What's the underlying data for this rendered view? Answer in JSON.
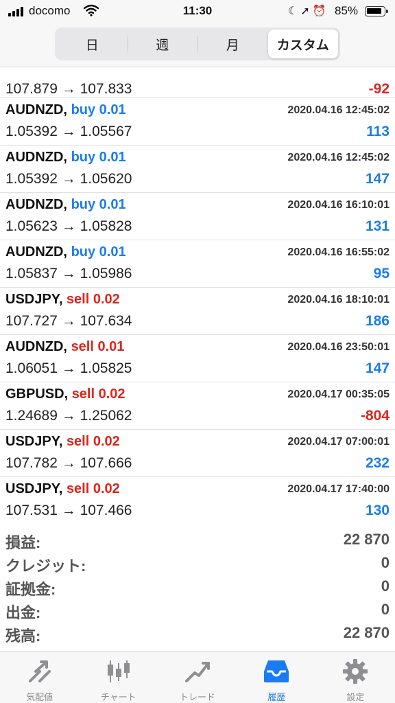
{
  "status_bar": {
    "carrier": "docomo",
    "time": "11:30",
    "battery": "85%",
    "icons": [
      "moon-icon",
      "location-icon",
      "alarm-icon"
    ]
  },
  "header": {
    "segments": [
      "日",
      "週",
      "月",
      "カスタム"
    ],
    "active_segment": "カスタム"
  },
  "trades": {
    "partial": {
      "prices": "107.879 → 107.833",
      "profit": "-92"
    },
    "rows": [
      {
        "symbol": "AUDNZD,",
        "side": "buy 0.01",
        "time": "2020.04.16 12:45:02",
        "prices": "1.05392 → 1.05567",
        "profit": "113"
      },
      {
        "symbol": "AUDNZD,",
        "side": "buy 0.01",
        "time": "2020.04.16 12:45:02",
        "prices": "1.05392 → 1.05620",
        "profit": "147"
      },
      {
        "symbol": "AUDNZD,",
        "side": "buy 0.01",
        "time": "2020.04.16 16:10:01",
        "prices": "1.05623 → 1.05828",
        "profit": "131"
      },
      {
        "symbol": "AUDNZD,",
        "side": "buy 0.01",
        "time": "2020.04.16 16:55:02",
        "prices": "1.05837 → 1.05986",
        "profit": "95"
      },
      {
        "symbol": "USDJPY,",
        "side": "sell 0.02",
        "time": "2020.04.16 18:10:01",
        "prices": "107.727 → 107.634",
        "profit": "186"
      },
      {
        "symbol": "AUDNZD,",
        "side": "sell 0.01",
        "time": "2020.04.16 23:50:01",
        "prices": "1.06051 → 1.05825",
        "profit": "147"
      },
      {
        "symbol": "GBPUSD,",
        "side": "sell 0.02",
        "time": "2020.04.17 00:35:05",
        "prices": "1.24689 → 1.25062",
        "profit": "-804"
      },
      {
        "symbol": "USDJPY,",
        "side": "sell 0.02",
        "time": "2020.04.17 07:00:01",
        "prices": "107.782 → 107.666",
        "profit": "232"
      },
      {
        "symbol": "USDJPY,",
        "side": "sell 0.02",
        "time": "2020.04.17 17:40:00",
        "prices": "107.531 → 107.466",
        "profit": "130"
      }
    ]
  },
  "summary": [
    {
      "label": "損益:",
      "value": "22 870"
    },
    {
      "label": "クレジット:",
      "value": "0"
    },
    {
      "label": "証拠金:",
      "value": "0"
    },
    {
      "label": "出金:",
      "value": "0"
    },
    {
      "label": "残高:",
      "value": "22 870"
    }
  ],
  "tabbar": {
    "tabs": [
      {
        "label": "気配値",
        "icon": "quotes-arrows-icon"
      },
      {
        "label": "チャート",
        "icon": "candlestick-chart-icon"
      },
      {
        "label": "トレード",
        "icon": "trade-line-icon"
      },
      {
        "label": "履歴",
        "icon": "inbox-tray-icon"
      },
      {
        "label": "設定",
        "icon": "gear-icon"
      }
    ],
    "active_tab": "履歴"
  },
  "colors": {
    "buy": "#1a7cf0",
    "sell": "#e0241b",
    "positive_profit": "#1a7cf0",
    "negative_profit": "#e0241b",
    "active_tab": "#1a7cf0",
    "inactive_tab": "#8e8e93"
  }
}
